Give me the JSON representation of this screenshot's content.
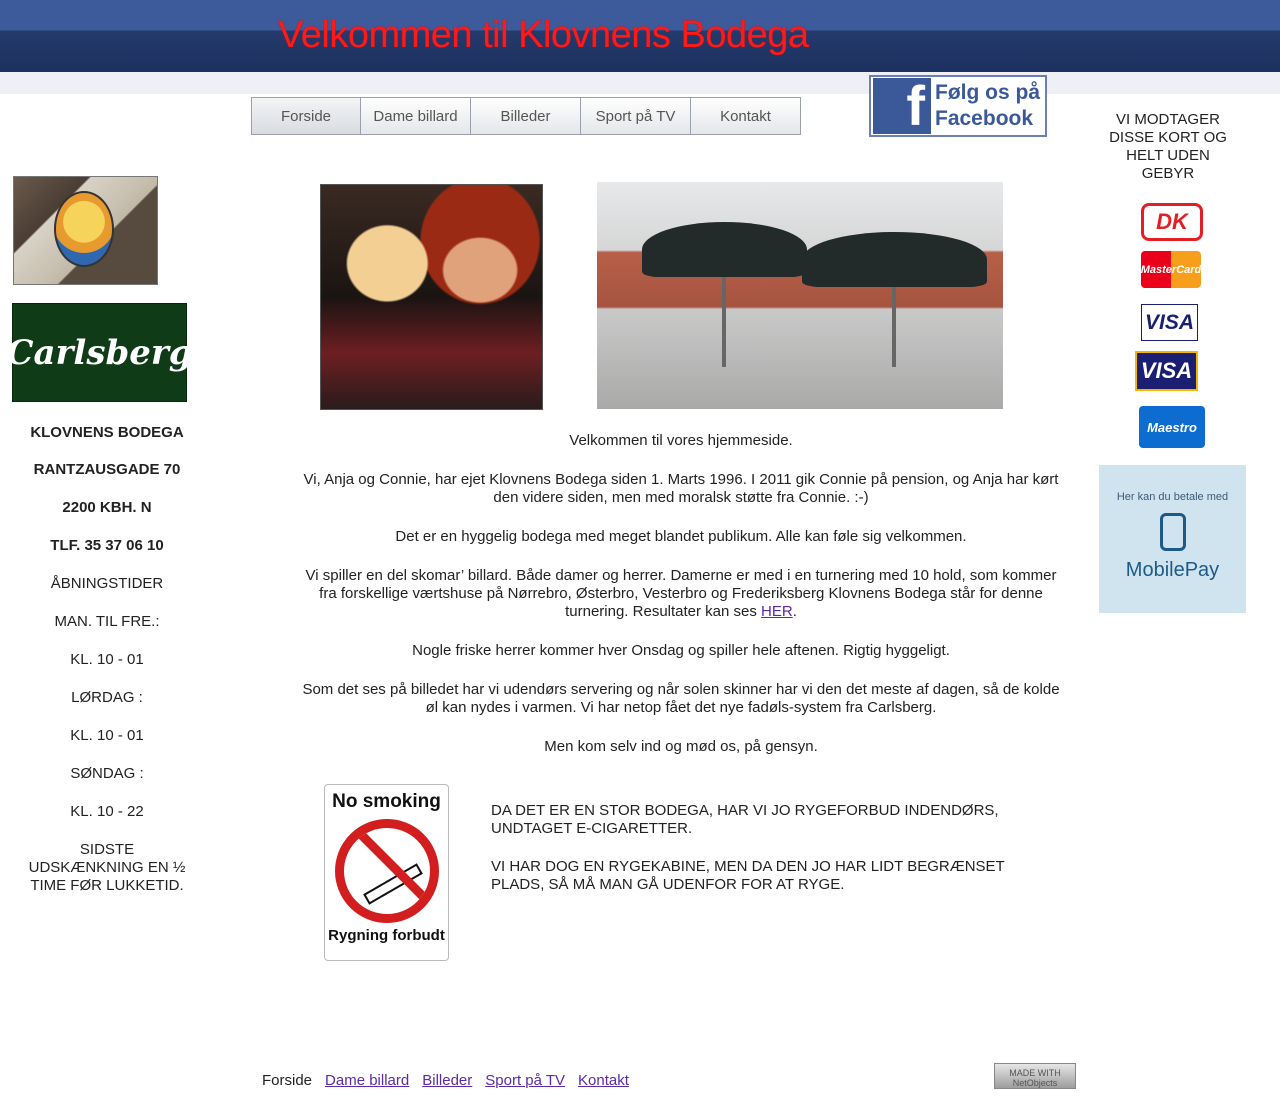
{
  "header": {
    "title": "Velkommen til Klovnens Bodega"
  },
  "nav": {
    "tabs": [
      "Forside",
      "Dame billard",
      "Billeder",
      "Sport på TV",
      "Kontakt"
    ]
  },
  "facebook": {
    "line1": "Følg os på",
    "line2": "Facebook",
    "logo_letter": "f"
  },
  "left": {
    "carlsberg_logo": "Carlsberg",
    "name": "KLOVNENS BODEGA",
    "address": "RANTZAUSGADE 70",
    "city": "2200 KBH.  N",
    "phone": "TLF. 35 37 06 10",
    "hours_title": "ÅBNINGSTIDER",
    "weekday_label": "MAN. TIL FRE.:",
    "weekday_hours": "KL. 10 - 01",
    "saturday_label": "LØRDAG :",
    "saturday_hours": "KL. 10 - 01",
    "sunday_label": "SØNDAG :",
    "sunday_hours": "KL. 10 - 22",
    "last_call": "SIDSTE UDSKÆNKNING EN ½ TIME FØR LUKKETID."
  },
  "main": {
    "welcome": "Velkommen til vores hjemmeside.",
    "p1": "Vi, Anja og Connie, har ejet Klovnens Bodega siden 1. Marts 1996. I 2011 gik Connie på pension, og Anja har kørt den videre siden, men med moralsk støtte fra Connie. :-)",
    "p2": "Det er en hyggelig bodega med meget blandet publikum. Alle kan føle sig velkommen.",
    "p3_before": "Vi spiller en del skomar’ billard. Både damer og herrer. Damerne er med i en turnering med 10 hold, som kommer fra forskellige værtshuse på Nørrebro, Østerbro, Vesterbro og Frederiksberg Klovnens Bodega står for denne turnering. Resultater kan ses ",
    "p3_link": "HER",
    "p3_after": ".",
    "p4": "Nogle friske herrer kommer hver Onsdag og spiller hele aftenen. Rigtig hyggeligt.",
    "p5": "Som det ses på billedet har vi udendørs servering og når solen skinner har vi den det meste af dagen, så de kolde øl kan nydes i varmen. Vi har netop fået det nye fadøls-system fra Carlsberg.",
    "p6": "Men kom selv ind og mød os, på gensyn."
  },
  "smoking": {
    "sign_top": "No smoking",
    "sign_bottom": "Rygning forbudt",
    "text1": "DA DET ER EN STOR BODEGA, HAR VI JO RYGEFORBUD INDENDØRS, UNDTAGET E-CIGARETTER.",
    "text2": "VI HAR DOG EN RYGEKABINE, MEN DA DEN JO HAR LIDT BEGRÆNSET PLADS, SÅ MÅ MAN GÅ UDENFOR FOR AT RYGE."
  },
  "right": {
    "cards_title": "VI MODTAGER DISSE KORT OG HELT UDEN GEBYR",
    "cards": [
      "DK",
      "MasterCard",
      "VISA",
      "VISA",
      "Maestro"
    ],
    "mobilepay_small": "Her kan du betale med",
    "mobilepay_name": "MobilePay"
  },
  "footer": {
    "current": "Forside",
    "links": [
      "Dame billard",
      "Billeder",
      "Sport på TV",
      "Kontakt"
    ],
    "badge": "MADE WITH NetObjects"
  },
  "colors": {
    "title_red": "#ff1a1a",
    "banner_blue": "#3d5a9a",
    "link_purple": "#5a2aa8",
    "facebook_blue": "#3b5998"
  }
}
